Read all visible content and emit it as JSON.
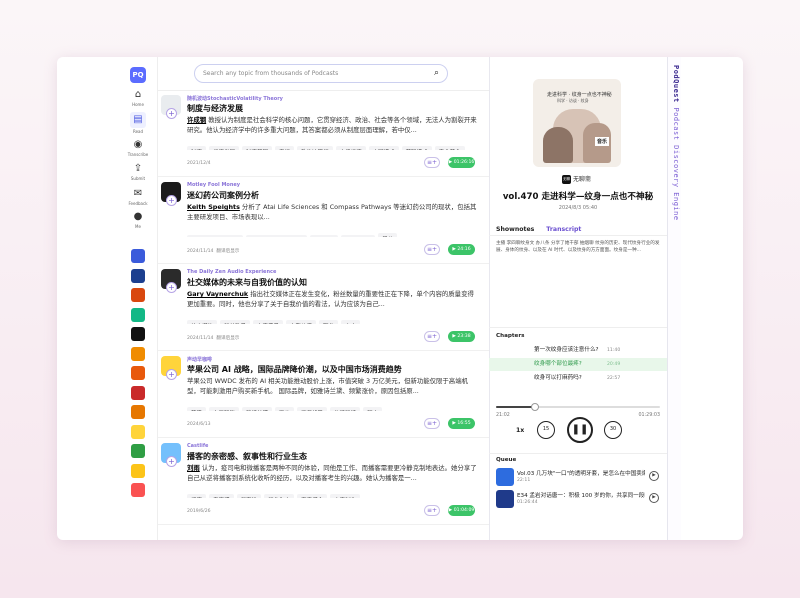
{
  "app": {
    "logo": "PQ",
    "brand": "PodQuest",
    "tagline": "Podcast Discovery Engine"
  },
  "nav": {
    "items": [
      {
        "label": "Home",
        "icon": "home-icon",
        "glyph": "⌂"
      },
      {
        "label": "Read",
        "icon": "read-icon",
        "glyph": "▤"
      },
      {
        "label": "Transcribe",
        "icon": "transcribe-icon",
        "glyph": "◉"
      },
      {
        "label": "Submit",
        "icon": "submit-icon",
        "glyph": "⇪"
      },
      {
        "label": "Feedback",
        "icon": "feedback-icon",
        "glyph": "✉"
      },
      {
        "label": "Me",
        "icon": "avatar-icon",
        "glyph": "●"
      }
    ],
    "podcast_colors": [
      "#3b5bdb",
      "#1c3f8f",
      "#d9480f",
      "#12b886",
      "#111111",
      "#f08c00",
      "#e8590c",
      "#c92a2a",
      "#e67700",
      "#ffd43b",
      "#2f9e44",
      "#fcc419",
      "#fa5252"
    ]
  },
  "search": {
    "placeholder": "Search any topic from thousands of Podcasts"
  },
  "feed": [
    {
      "podcast": "随机波动StochasticVolatility Theory",
      "title": "制度与经济发展",
      "author": "许成钢",
      "body": " 教授认为制度是社会科学的核心问题，它贯穿经济、政治、社会等各个领域，无法人为割裂开来研究。他认为经济学中的许多重大问题，其答案都必须从制度层面理解，若中仅...",
      "tags": [
        "制度",
        "经济发展",
        "制度基因",
        "产权",
        "政治决策权",
        "市场经济",
        "中国模式",
        "苏联模式",
        "产业革命"
      ],
      "date": "2021/12/4",
      "duration": "01:26:16",
      "cover": "#e9ecef"
    },
    {
      "podcast": "Motley Fool Money",
      "title": "迷幻药公司案例分析",
      "author": "Keith Speights",
      "body": " 分析了 Atai Life Sciences 和 Compass Pathways 等迷幻药公司的现状，包括其主要研发项目、市场表现以...",
      "tags": [
        "Atai Life Sciences",
        "Compass Pathways",
        "RL-007",
        "COMP360",
        "股价"
      ],
      "date": "2024/11/14",
      "extra": "翻译后显示",
      "duration": "24:16",
      "cover": "#1b1b1b"
    },
    {
      "podcast": "The Daily Zen Audio Experience",
      "title": "社交媒体的未来与自我价值的认知",
      "author": "Gary Vaynerchuk",
      "body": " 指出社交媒体正在发生变化，粉丝数量的重要性正在下降，单个内容的质量变得更加重要。同时，他也分享了关于自我价值的看法，认为应该为自己...",
      "tags": [
        "社交媒体",
        "粉丝数量",
        "内容质量",
        "自我价值",
        "职业",
        "心态"
      ],
      "date": "2024/11/14",
      "extra": "翻译后显示",
      "duration": "23:38",
      "cover": "#2b2b2b"
    },
    {
      "podcast": "声动早咖啡",
      "title": "苹果公司 AI 战略，国际品牌降价潮，以及中国市场消费趋势",
      "author": "",
      "body": "苹果公司 WWDC 发布的 AI 相关功能推动股价上涨，市值突破 3 万亿美元，但新功能仅限于高端机型，可能刺激用户购买新手机。 国际品牌，如雅诗兰黛、频繁涨价，原因包括原...",
      "tags": [
        "苹果",
        "人工智能",
        "雅诗兰黛",
        "涨价",
        "消费趋势",
        "炸鸡玛特",
        "积木"
      ],
      "date": "2024/6/13",
      "duration": "16:55",
      "cover": "#ffd43b"
    },
    {
      "podcast": "Castlife",
      "title": "播客的亲密感、叙事性和行业生态",
      "author": "刘雨",
      "body": " 认为，疫司电和微播客是两种不同的体验，同他是工作、而播客需要更冷静克制地表达。她分享了自己从逆将播客到系统化收听的经历，以及对播客考生的兴趣。她认为播客是一...",
      "tags": [
        "播客",
        "亲密感",
        "叙事性",
        "行业生态",
        "声音媒介",
        "内容制作"
      ],
      "date": "2019/6/26",
      "duration": "01:04:09",
      "cover": "#74c0fc"
    }
  ],
  "player": {
    "art_headline": "走进科学 · 纹身一点也不神秘",
    "art_sub": "科学 · 访谈 · 纹身",
    "art_stamp": "音乐",
    "channel_badge": "无聊",
    "channel": "无聊斋",
    "title": "vol.470 走进科学—纹身一点也不神秘",
    "date": "2024/8/3 05:40",
    "tabs": [
      "Shownotes",
      "Transcript"
    ],
    "shownotes": "主播 李四聊纹身文 办八条 分享了她干部 抽烟聊 纹身的历史、现代纹身行业的发展、身体的纹身、以及在 AI 时代、以及纹身的方方面面。纹身是一种...",
    "chapters_label": "Chapters",
    "chapters": [
      {
        "title": "第一次纹身应该注意什么?",
        "time": "11:40"
      },
      {
        "title": "纹身哪个部位最疼?",
        "time": "20:49"
      },
      {
        "title": "纹身可以打麻药吗?",
        "time": "22:57"
      }
    ],
    "current_chapter": 1,
    "elapsed": "21:02",
    "total": "01:29:03",
    "progress": 0.236,
    "speed": "1x",
    "skip_back": "15",
    "skip_fwd": "30",
    "queue_label": "Queue",
    "queue": [
      {
        "title": "Vol.03 几万块\"一口\"的透明牙套，是怎么在中国卖爆的?",
        "duration": "22:11",
        "cover": "#2d6cdf"
      },
      {
        "title": "E34 孟岩对话唐一：积极 100 岁的你，共享同一段时间",
        "duration": "01:26:44",
        "cover": "#1f3a8a"
      }
    ]
  },
  "icons": {
    "search": "search-icon",
    "play": "play-icon",
    "queue_add": "queue-add-icon"
  }
}
